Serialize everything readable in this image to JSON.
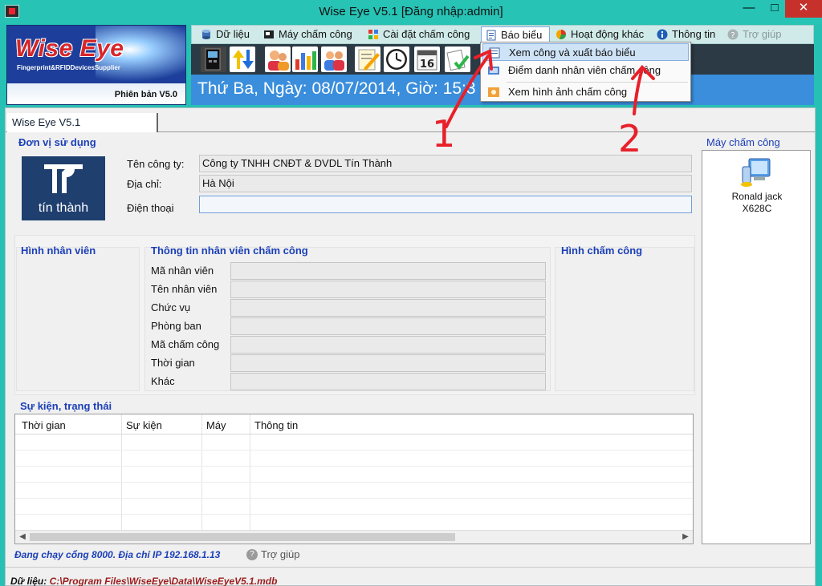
{
  "window": {
    "title": "Wise Eye V5.1 [Đăng nhập:admin]",
    "min_glyph": "—",
    "max_glyph": "□",
    "close_glyph": "✕"
  },
  "brand": {
    "logo_text": "Wise Eye",
    "tagline": "Fingerprint&RFIDDevicesSupplier",
    "version": "Phiên bản V5.0"
  },
  "menu": {
    "items": [
      {
        "label": "Dữ liệu",
        "icon": "database-icon"
      },
      {
        "label": "Máy chấm công",
        "icon": "device-icon"
      },
      {
        "label": "Cài đặt chấm công",
        "icon": "settings-grid-icon"
      },
      {
        "label": "Báo biểu",
        "icon": "report-icon"
      },
      {
        "label": "Hoạt động khác",
        "icon": "pie-chart-icon"
      },
      {
        "label": "Thông tin",
        "icon": "info-icon"
      },
      {
        "label": "Trợ giúp",
        "icon": "help-icon"
      }
    ]
  },
  "report_menu": {
    "items": [
      {
        "label": "Xem công và xuất báo biểu",
        "icon": "export-report-icon"
      },
      {
        "label": "Điểm danh nhân viên chấm công",
        "icon": "roll-call-icon"
      },
      {
        "label": "Xem hình ảnh chấm công",
        "icon": "photo-icon"
      }
    ]
  },
  "datebar": {
    "text": "Thứ Ba, Ngày: 08/07/2014, Giờ: 15:3"
  },
  "toolbar": {
    "calendar_day": "16"
  },
  "tab": {
    "label": "Wise Eye V5.1"
  },
  "company": {
    "section_title": "Đơn vị sử dụng",
    "logo_name": "tín thành",
    "name_label": "Tên công ty:",
    "name_value": "Công ty TNHH CNĐT & DVDL Tín Thành",
    "address_label": "Địa chỉ:",
    "address_value": "Hà Nội",
    "phone_label": "Điện thoại",
    "phone_value": ""
  },
  "employee": {
    "photo_title": "Hình nhân viên",
    "info_title": "Thông tin nhân viên chấm công",
    "checkin_photo_title": "Hình chấm công",
    "fields": [
      {
        "label": "Mã nhân viên",
        "value": ""
      },
      {
        "label": "Tên nhân viên",
        "value": ""
      },
      {
        "label": "Chức vụ",
        "value": ""
      },
      {
        "label": "Phòng ban",
        "value": ""
      },
      {
        "label": "Mã chấm công",
        "value": ""
      },
      {
        "label": "Thời gian",
        "value": ""
      },
      {
        "label": "Khác",
        "value": ""
      }
    ]
  },
  "devices": {
    "title": "Máy chấm công",
    "items": [
      {
        "name_line1": "Ronald jack",
        "name_line2": "X628C"
      }
    ]
  },
  "events": {
    "title": "Sự kiện, trạng thái",
    "columns": [
      "Thời gian",
      "Sự kiện",
      "Máy",
      "Thông tin"
    ],
    "rows": []
  },
  "status": {
    "text": "Đang chạy cổng 8000. Địa chỉ IP 192.168.1.13",
    "help_label": "Trợ giúp",
    "db_label": "Dữ liệu:",
    "db_path": "C:\\Program Files\\WiseEye\\Data\\WiseEyeV5.1.mdb"
  },
  "annotations": {
    "number_1": "1",
    "number_2": "2",
    "color": "#e8202a"
  }
}
